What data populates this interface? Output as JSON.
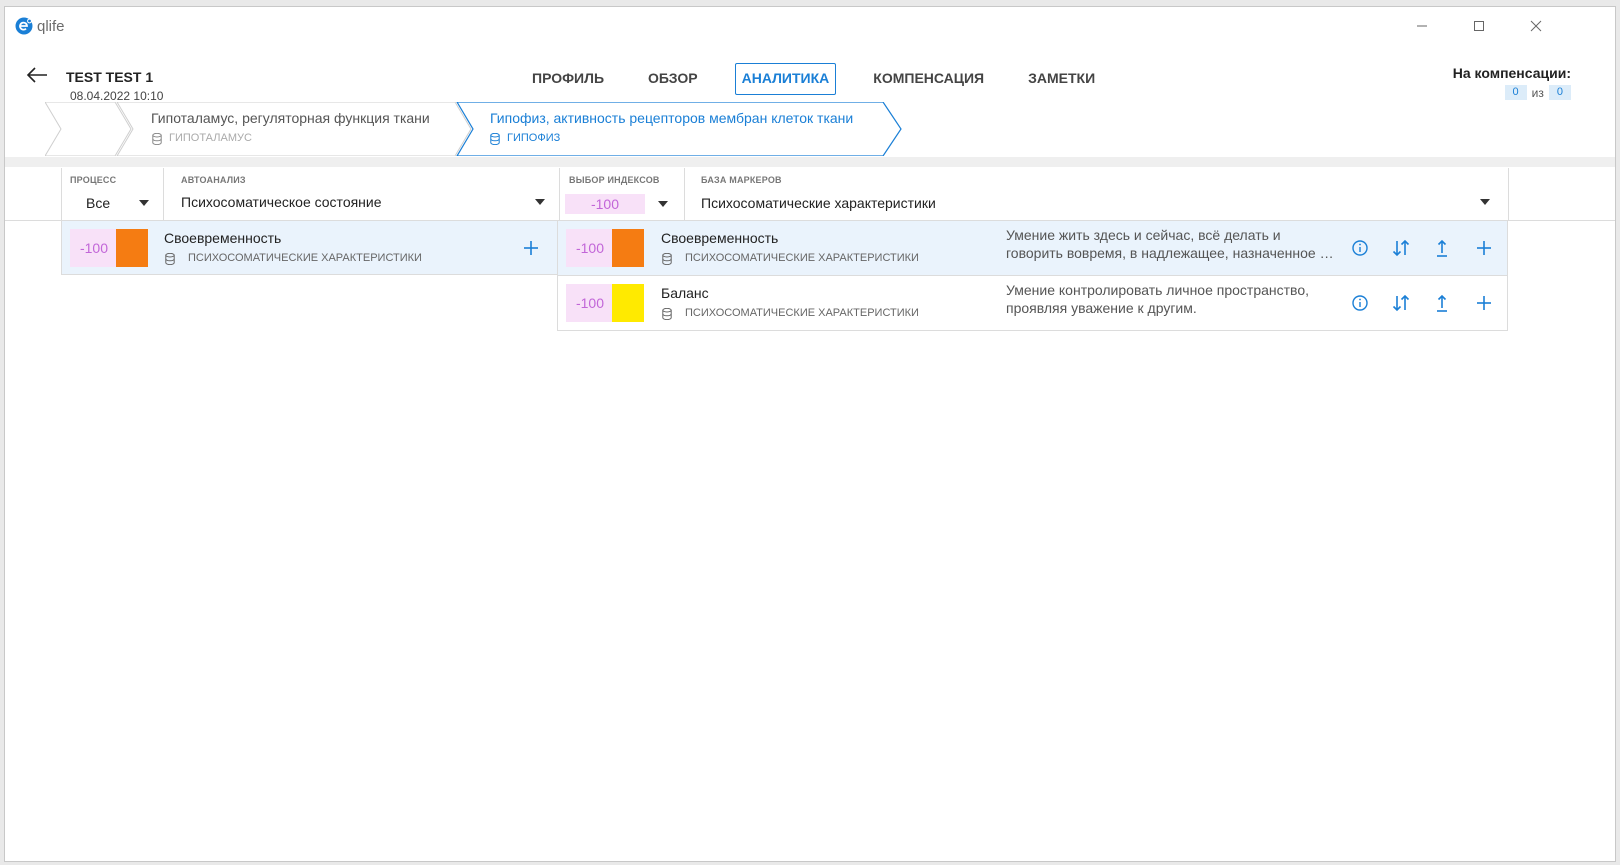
{
  "app": {
    "name": "qlife"
  },
  "patient": {
    "name": "TEST TEST 1",
    "date": "08.04.2022 10:10"
  },
  "tabs": [
    {
      "label": "ПРОФИЛЬ",
      "active": false
    },
    {
      "label": "ОБЗОР",
      "active": false
    },
    {
      "label": "АНАЛИТИКА",
      "active": true
    },
    {
      "label": "КОМПЕНСАЦИЯ",
      "active": false
    },
    {
      "label": "ЗАМЕТКИ",
      "active": false
    }
  ],
  "compensation": {
    "label": "На компенсации:",
    "current": "0",
    "of": "из",
    "total": "0"
  },
  "breadcrumb": [
    {
      "title": "Гипоталамус, регуляторная функция ткани",
      "subtitle": "ГИПОТАЛАМУС"
    },
    {
      "title": "Гипофиз, активность рецепторов мембран клеток ткани",
      "subtitle": "ГИПОФИЗ"
    }
  ],
  "filters": {
    "process": {
      "label": "ПРОЦЕСС",
      "value": "Все"
    },
    "autoanalysis": {
      "label": "АВТОАНАЛИЗ",
      "value": "Психосоматическое состояние"
    },
    "index": {
      "label": "ВЫБОР ИНДЕКСОВ",
      "value": "-100"
    },
    "markers": {
      "label": "БАЗА МАРКЕРОВ",
      "value": "Психосоматические характеристики"
    }
  },
  "left_rows": [
    {
      "index": "-100",
      "title": "Своевременность",
      "subtitle": "ПСИХОСОМАТИЧЕСКИЕ ХАРАКТЕРИСТИКИ",
      "color": "#f57c12"
    }
  ],
  "right_rows": [
    {
      "index": "-100",
      "title": "Своевременность",
      "subtitle": "ПСИХОСОМАТИЧЕСКИЕ ХАРАКТЕРИСТИКИ",
      "color": "#f57c12",
      "desc1": "Умение жить здесь и сейчас, всё делать и",
      "desc2": "говорить вовремя, в надлежащее, назначенное время."
    },
    {
      "index": "-100",
      "title": "Баланс",
      "subtitle": "ПСИХОСОМАТИЧЕСКИЕ ХАРАКТЕРИСТИКИ",
      "color": "#ffea00",
      "desc1": "Умение контролировать личное пространство,",
      "desc2": "проявляя уважение к другим."
    }
  ],
  "colors": {
    "accent": "#1a7fd6",
    "index_bg": "#f8e1f8",
    "index_text": "#c266d8"
  }
}
